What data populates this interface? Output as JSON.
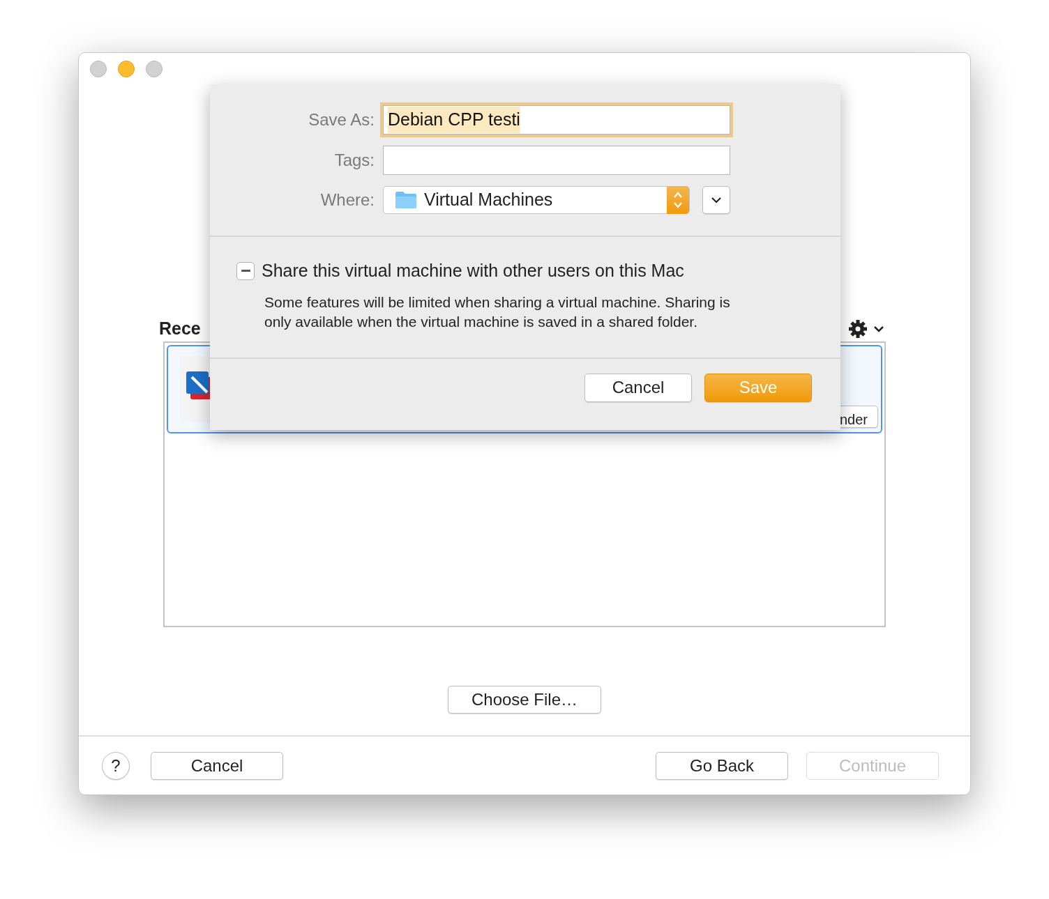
{
  "window": {
    "traffic_lights": [
      {
        "kind": "close",
        "active": false
      },
      {
        "kind": "minimize",
        "active": true
      },
      {
        "kind": "zoom",
        "active": false
      }
    ]
  },
  "recent": {
    "heading": "Rece",
    "rows": [
      {
        "selected": true,
        "button": "nder"
      }
    ]
  },
  "choose_file_button": "Choose File…",
  "footer": {
    "help": "?",
    "buttons": [
      {
        "label": "Cancel",
        "disabled": false
      },
      {
        "label": "Go Back",
        "disabled": false
      },
      {
        "label": "Continue",
        "disabled": true
      }
    ]
  },
  "sheet": {
    "save_as": {
      "label": "Save As:",
      "value": "Debian CPP testi",
      "focused": true
    },
    "tags": {
      "label": "Tags:"
    },
    "where": {
      "label": "Where:",
      "value": "Virtual Machines"
    },
    "share": {
      "label": "Share this virtual machine with other users on this Mac",
      "mixed": true,
      "description": "Some features will be limited when sharing a virtual machine. Sharing is only available when the virtual machine is saved in a shared folder."
    },
    "buttons": [
      {
        "label": "Cancel",
        "default": false
      },
      {
        "label": "Save",
        "default": true
      }
    ]
  }
}
